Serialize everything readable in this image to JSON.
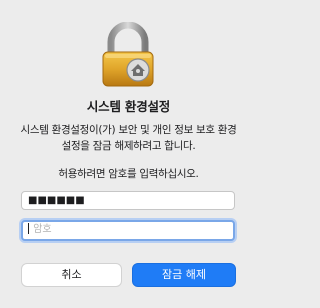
{
  "dialog": {
    "title": "시스템 환경설정",
    "message": "시스템 환경설정이(가) 보안 및 개인 정보 보호 환경설정을 잠금 해제하려고 합니다.",
    "prompt": "허용하려면 암호를 입력하십시오.",
    "username_value": "■■■■■■",
    "password_placeholder": "암호",
    "cancel_label": "취소",
    "unlock_label": "잠금 해제",
    "lock_icon": "lock-icon",
    "accent_color": "#1f7cf6"
  }
}
